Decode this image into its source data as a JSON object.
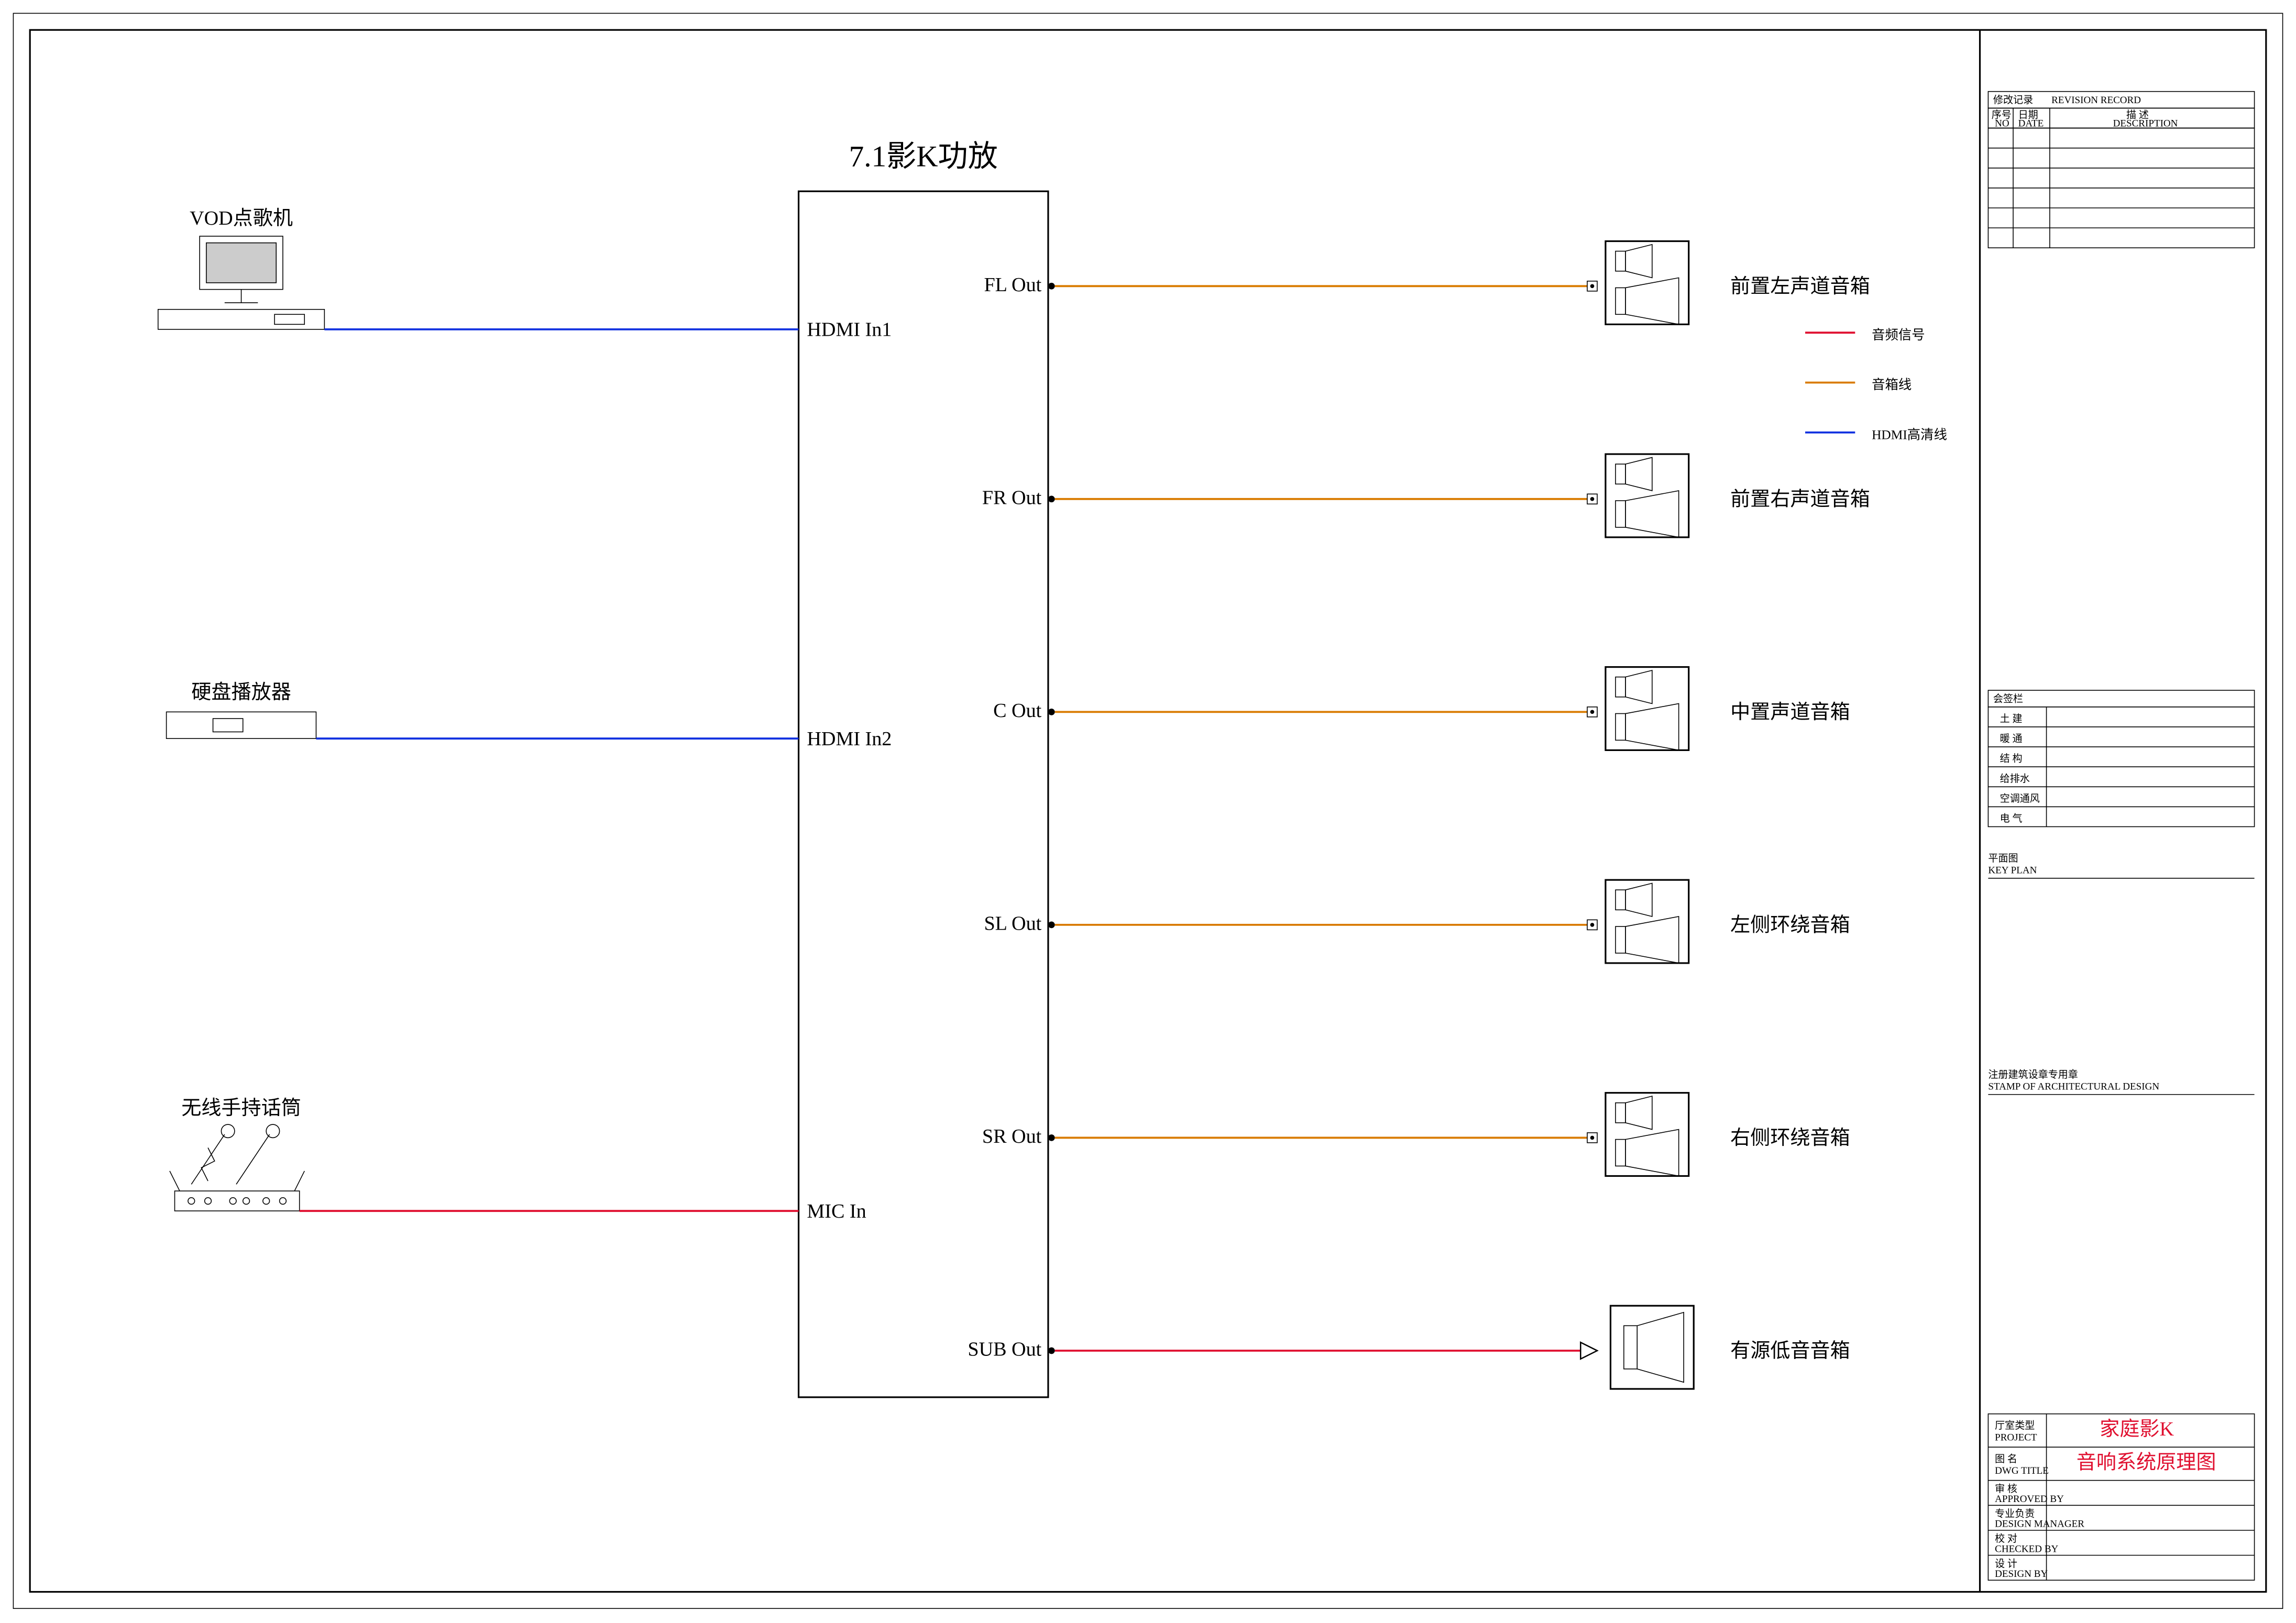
{
  "title": "7.1影K功放",
  "sources": {
    "vod": {
      "label": "VOD点歌机",
      "port": "HDMI In1"
    },
    "hdd": {
      "label": "硬盘播放器",
      "port": "HDMI In2"
    },
    "mic": {
      "label": "无线手持话筒",
      "port": "MIC In"
    }
  },
  "outputs": [
    {
      "port": "FL Out",
      "speaker": "前置左声道音箱",
      "line": "orange"
    },
    {
      "port": "FR Out",
      "speaker": "前置右声道音箱",
      "line": "orange"
    },
    {
      "port": "C Out",
      "speaker": "中置声道音箱",
      "line": "orange"
    },
    {
      "port": "SL Out",
      "speaker": "左侧环绕音箱",
      "line": "orange"
    },
    {
      "port": "SR Out",
      "speaker": "右侧环绕音箱",
      "line": "orange"
    },
    {
      "port": "SUB Out",
      "speaker": "有源低音音箱",
      "line": "red"
    }
  ],
  "legend": {
    "audio": "音频信号",
    "speaker": "音箱线",
    "hdmi": "HDMI高清线"
  },
  "titleblock": {
    "revision_header": "修改记录",
    "revision_header_en": "REVISION RECORD",
    "rev_cols": {
      "c1": "序号",
      "c1e": "NO",
      "c2": "日期",
      "c2e": "DATE",
      "c3": "描  述",
      "c3e": "DESCRIPTION"
    },
    "sig_header": "会签栏",
    "sig_rows": [
      "土 建",
      "暖 通",
      "结 构",
      "给排水",
      "空调通风",
      "电 气"
    ],
    "plan_hdr": "平面图",
    "plan_hdr_en": "KEY PLAN",
    "stamp_hdr": "注册建筑设章专用章",
    "stamp_hdr_en": "STAMP OF ARCHITECTURAL DESIGN",
    "row_project": "厅室类型",
    "row_project_en": "PROJECT",
    "row_project_val": "家庭影K",
    "row_title": "图  名",
    "row_title_en": "DWG TITLE",
    "row_title_val": "音响系统原理图",
    "row_approved": "审 核",
    "row_approved_en": "APPROVED BY",
    "row_manager": "专业负责",
    "row_manager_en": "DESIGN MANAGER",
    "row_checked": "校 对",
    "row_checked_en": "CHECKED BY",
    "row_design": "设 计",
    "row_design_en": "DESIGN BY"
  }
}
